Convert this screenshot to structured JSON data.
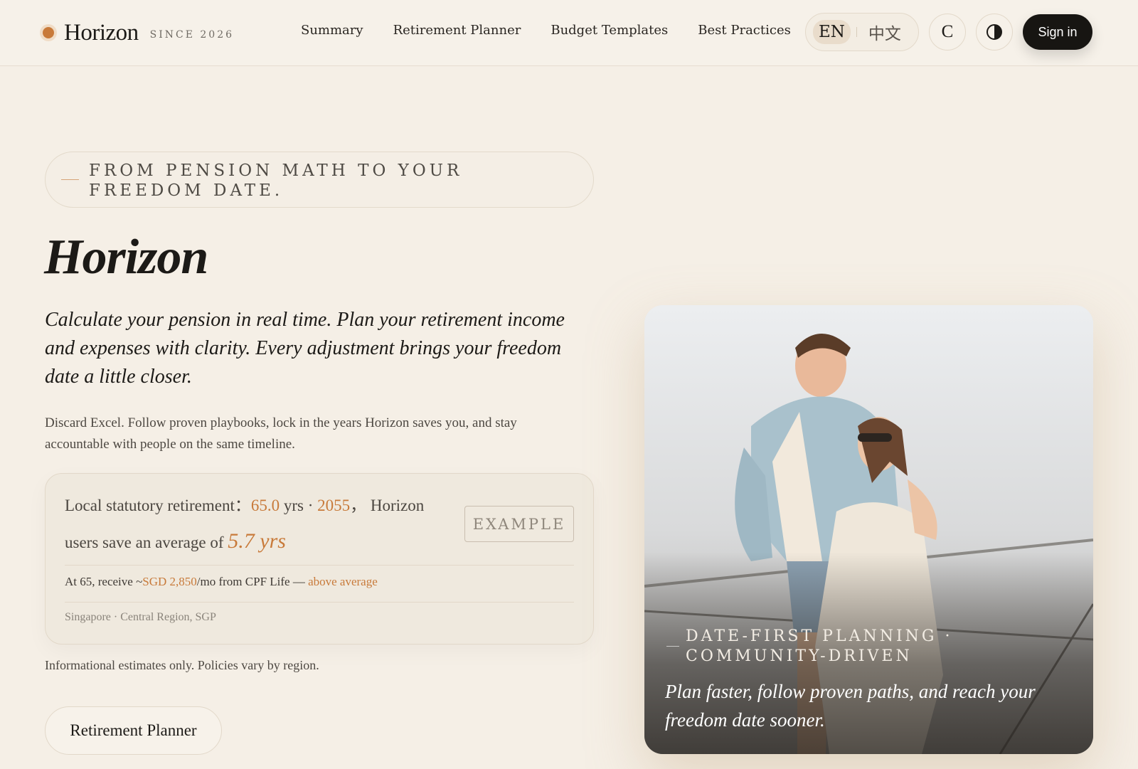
{
  "header": {
    "brand_name": "Horizon",
    "brand_since": "SINCE 2026",
    "nav": [
      "Summary",
      "Retirement Planner",
      "Budget Templates",
      "Best Practices"
    ],
    "lang_en": "EN",
    "lang_zh": "中文",
    "currency_btn": "C",
    "signin": "Sign in"
  },
  "hero": {
    "eyebrow": "From pension math to your freedom date.",
    "title": "Horizon",
    "lead": "Calculate your pension in real time. Plan your retirement income and expenses with clarity. Every adjustment brings your freedom date a little closer.",
    "sub": "Discard Excel. Follow proven playbooks, lock in the years Horizon saves you, and stay accountable with people on the same timeline."
  },
  "stat": {
    "prefix": "Local statutory retirement：",
    "age": "65.0",
    "age_unit": " yrs · ",
    "year": "2055",
    "mid": "， Horizon users save an average of ",
    "saved": "5.7 yrs",
    "example": "EXAMPLE",
    "cpf_prefix": "At 65, receive ~",
    "cpf_amount": "SGD 2,850",
    "cpf_suffix": "/mo from CPF Life — ",
    "cpf_rating": "above average",
    "location": "Singapore · Central Region, SGP"
  },
  "disclaimer": "Informational estimates only. Policies vary by region.",
  "cta": "Retirement Planner",
  "photo": {
    "eyebrow": "Date-first planning · community-driven",
    "quote": "Plan faster, follow proven paths, and reach your freedom date sooner."
  },
  "colors": {
    "accent": "#c87a3a",
    "background": "#f5efe6",
    "button_dark": "#171512"
  }
}
